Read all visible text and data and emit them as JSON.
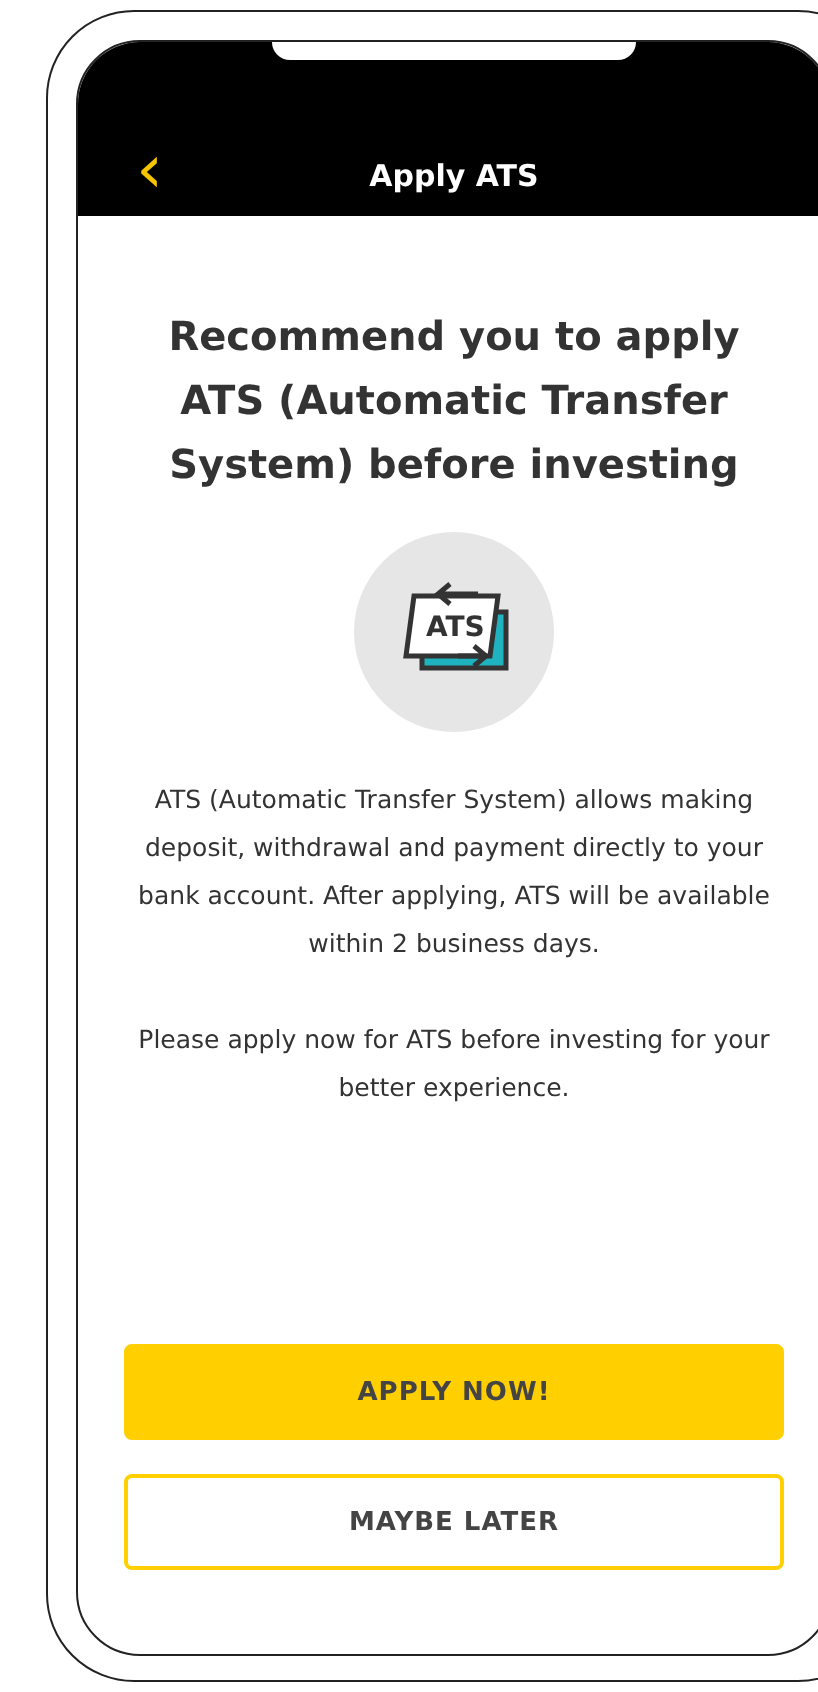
{
  "header": {
    "back_icon": "‹",
    "title": "Apply ATS"
  },
  "heading": "Recommend you to apply ATS (Automatic Transfer System) before investing",
  "illustration": {
    "label": "ATS"
  },
  "paragraphs": [
    "ATS (Automatic Transfer System) allows making deposit, withdrawal and payment directly to your bank account. After applying, ATS will be available within 2 business days.",
    "Please apply now for ATS before investing for your better experience."
  ],
  "buttons": [
    {
      "label": "APPLY NOW!",
      "kind": "primary"
    },
    {
      "label": "MAYBE LATER",
      "kind": "secondary"
    }
  ]
}
